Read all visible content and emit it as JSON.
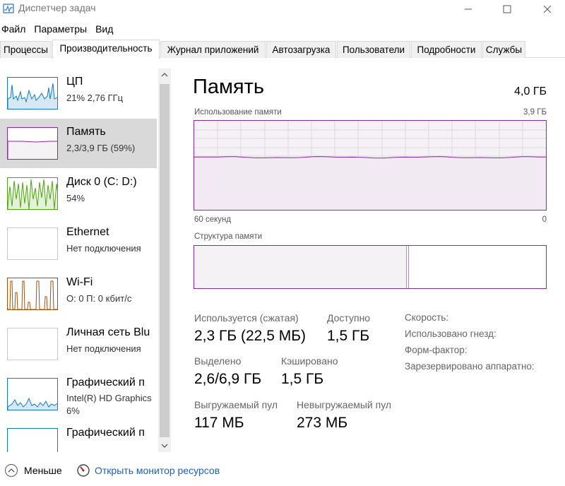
{
  "window": {
    "title": "Диспетчер задач"
  },
  "menu": [
    "Файл",
    "Параметры",
    "Вид"
  ],
  "tabs": [
    "Процессы",
    "Производительность",
    "Журнал приложений",
    "Автозагрузка",
    "Пользователи",
    "Подробности",
    "Службы"
  ],
  "active_tab": 1,
  "sidebar": {
    "items": [
      {
        "title": "ЦП",
        "sub1": "21%  2,76 ГГц",
        "sub2": ""
      },
      {
        "title": "Память",
        "sub1": "2,3/3,9 ГБ (59%)",
        "sub2": ""
      },
      {
        "title": "Диск 0 (C: D:)",
        "sub1": "54%",
        "sub2": ""
      },
      {
        "title": "Ethernet",
        "sub1": "Нет подключения",
        "sub2": ""
      },
      {
        "title": "Wi-Fi",
        "sub1": "О: 0 П: 0 кбит/с",
        "sub2": ""
      },
      {
        "title": "Личная сеть Blu",
        "sub1": "Нет подключения",
        "sub2": ""
      },
      {
        "title": "Графический п",
        "sub1": "Intel(R) HD Graphics",
        "sub2": "6%"
      },
      {
        "title": "Графический п",
        "sub1": "",
        "sub2": ""
      }
    ],
    "selected_index": 1
  },
  "main": {
    "title": "Память",
    "total": "4,0 ГБ",
    "usage_label": "Использование памяти",
    "usage_max": "3,9 ГБ",
    "time_left": "60 секунд",
    "time_right": "0",
    "structure_label": "Структура памяти",
    "stats": {
      "in_use_label": "Используется (сжатая)",
      "in_use_value": "2,3 ГБ (22,5 МБ)",
      "available_label": "Доступно",
      "available_value": "1,5 ГБ",
      "committed_label": "Выделено",
      "committed_value": "2,6/6,9 ГБ",
      "cached_label": "Кэшировано",
      "cached_value": "1,5 ГБ",
      "paged_label": "Выгружаемый пул",
      "paged_value": "117 МБ",
      "nonpaged_label": "Невыгружаемый пул",
      "nonpaged_value": "273 МБ"
    },
    "info": {
      "speed": "Скорость:",
      "slots": "Использовано гнезд:",
      "form": "Форм-фактор:",
      "reserved": "Зарезервировано аппаратно:"
    },
    "usage_level": 0.59,
    "structure_used_fraction": 0.605
  },
  "footer": {
    "less": "Меньше",
    "resmon": "Открыть монитор ресурсов"
  },
  "colors": {
    "memory": "#8b2a9e",
    "cpu": "#117dbb",
    "disk": "#4da60c",
    "wifi": "#a74f01",
    "gpu": "#117dbb",
    "link": "#1f5fbf"
  }
}
